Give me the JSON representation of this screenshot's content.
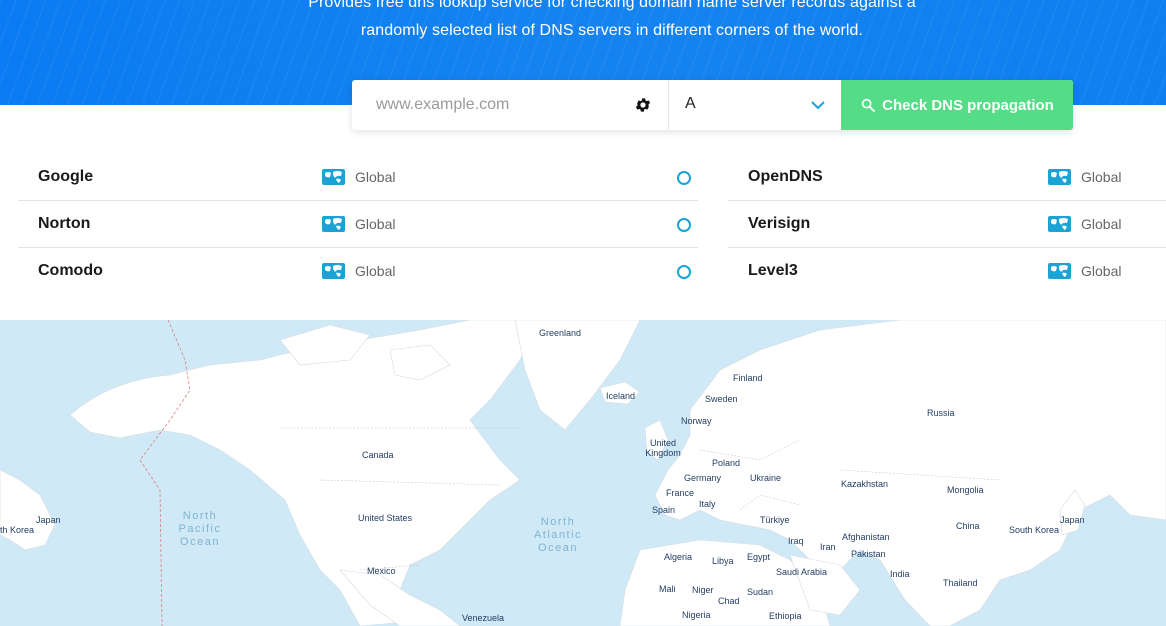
{
  "hero": {
    "text": "Provides free dns lookup service for checking domain name server records against a randomly selected list of DNS servers in different corners of the world."
  },
  "search": {
    "placeholder": "www.example.com",
    "value": "",
    "record_type": "A",
    "button_label": "Check DNS propagation"
  },
  "servers_left": [
    {
      "name": "Google",
      "location": "Global"
    },
    {
      "name": "Norton",
      "location": "Global"
    },
    {
      "name": "Comodo",
      "location": "Global"
    }
  ],
  "servers_right": [
    {
      "name": "OpenDNS",
      "location": "Global"
    },
    {
      "name": "Verisign",
      "location": "Global"
    },
    {
      "name": "Level3",
      "location": "Global"
    }
  ],
  "colors": {
    "hero_blue": "#0a7bf2",
    "button_green": "#54dc86",
    "status_ring": "#1aa3d4",
    "map_water": "#cfe9f7"
  },
  "map": {
    "countries": {
      "greenland": "Greenland",
      "iceland": "Iceland",
      "finland": "Finland",
      "sweden": "Sweden",
      "norway": "Norway",
      "russia": "Russia",
      "uk": "United Kingdom",
      "poland": "Poland",
      "germany": "Germany",
      "ukraine": "Ukraine",
      "france": "France",
      "kazakhstan": "Kazakhstan",
      "mongolia": "Mongolia",
      "spain": "Spain",
      "italy": "Italy",
      "turkiye": "Türkiye",
      "china": "China",
      "south_korea": "South Korea",
      "japan_east": "Japan",
      "japan_west": "Japan",
      "south_korea_west": "th Korea",
      "canada": "Canada",
      "usa": "United States",
      "mexico": "Mexico",
      "venezuela": "Venezuela",
      "iraq": "Iraq",
      "iran": "Iran",
      "afghanistan": "Afghanistan",
      "pakistan": "Pakistan",
      "india": "India",
      "thailand": "Thailand",
      "algeria": "Algeria",
      "libya": "Libya",
      "egypt": "Egypt",
      "saudi": "Saudi Arabia",
      "mali": "Mali",
      "niger": "Niger",
      "chad": "Chad",
      "sudan": "Sudan",
      "nigeria": "Nigeria",
      "ethiopia": "Ethiopia"
    },
    "oceans": {
      "north_pacific": "North Pacific Ocean",
      "north_atlantic": "North Atlantic Ocean"
    }
  }
}
